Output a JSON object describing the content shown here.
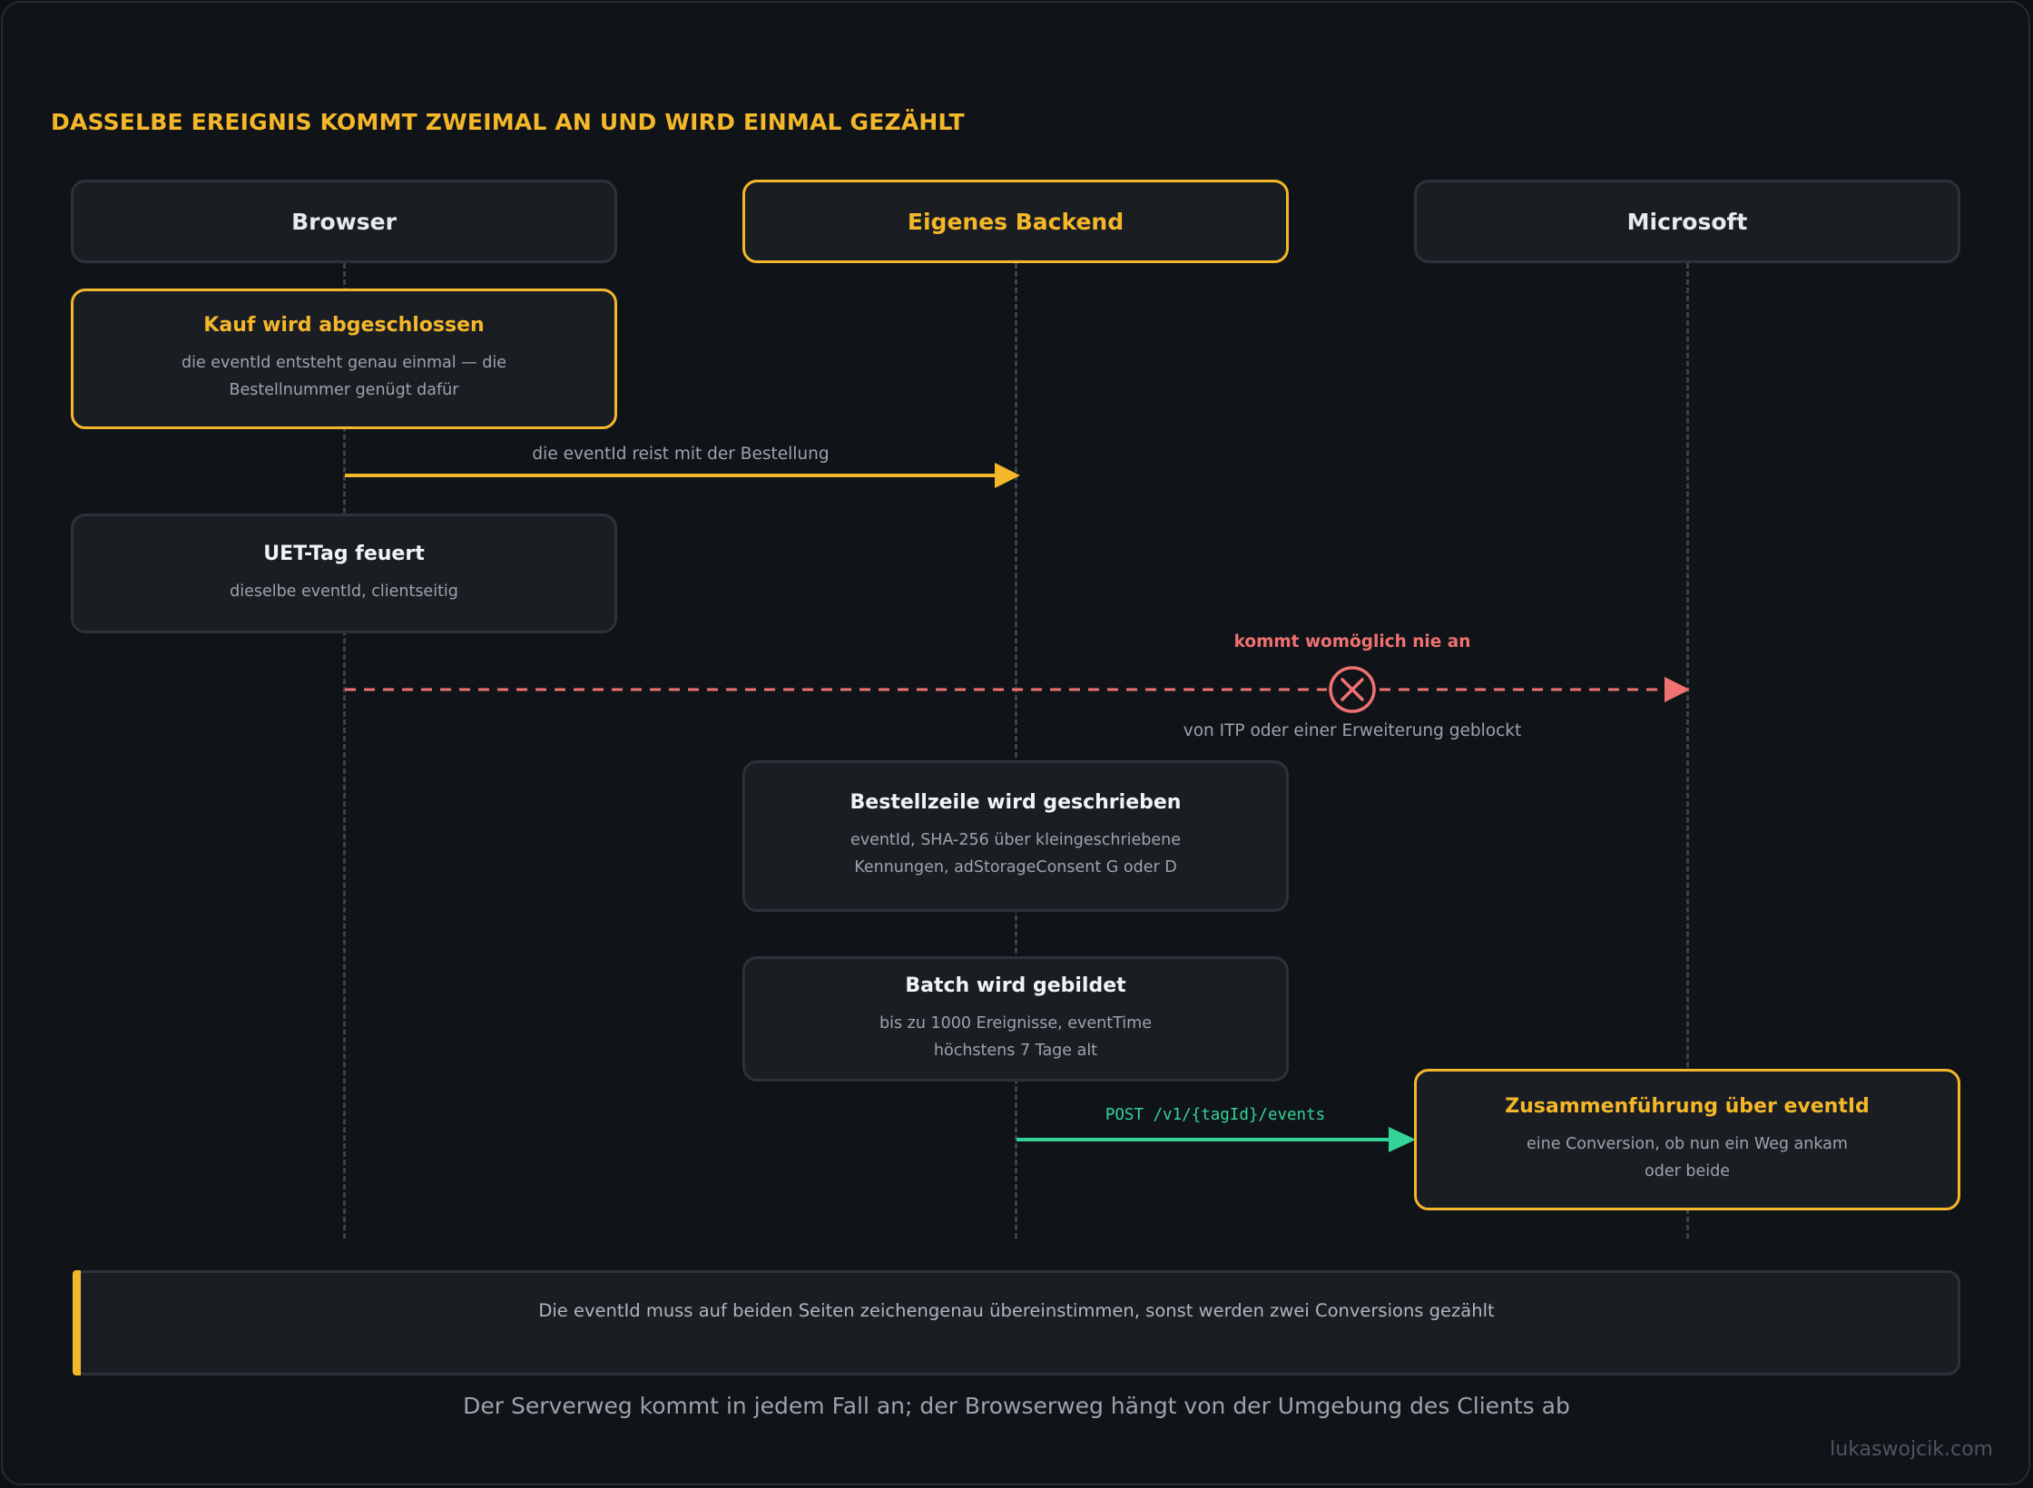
{
  "heading": "DASSELBE EREIGNIS KOMMT ZWEIMAL AN UND WIRD EINMAL GEZÄHLT",
  "lanes": {
    "browser": "Browser",
    "backend": "Eigenes Backend",
    "microsoft": "Microsoft"
  },
  "steps": {
    "kauf": {
      "title": "Kauf wird abgeschlossen",
      "sub": "die eventId entsteht genau einmal — die Bestellnummer genügt dafür"
    },
    "uet": {
      "title": "UET-Tag feuert",
      "sub": "dieselbe eventId, clientseitig"
    },
    "bestellzeile": {
      "title": "Bestellzeile wird geschrieben",
      "sub": "eventId, SHA-256 über kleingeschriebene Kennungen, adStorageConsent G oder D"
    },
    "batch": {
      "title": "Batch wird gebildet",
      "sub": "bis zu 1000 Ereignisse, eventTime höchstens 7 Tage alt"
    },
    "merge": {
      "title": "Zusammenführung über eventId",
      "sub": "eine Conversion, ob nun ein Weg ankam oder beide"
    }
  },
  "messages": {
    "order": "die eventId reist mit der Bestellung",
    "blocked_top": "kommt womöglich nie an",
    "blocked_bottom": "von ITP oder einer Erweiterung geblockt",
    "post": "POST /v1/{tagId}/events"
  },
  "note": "Die eventId muss auf beiden Seiten zeichengenau übereinstimmen, sonst werden zwei Conversions gezählt",
  "caption": "Der Serverweg kommt in jedem Fall an; der Browserweg hängt von der Umgebung des Clients ab",
  "watermark": "lukaswojcik.com",
  "colors": {
    "accent": "#f5b72a",
    "blocked": "#f07171",
    "server": "#34d399",
    "background": "#101418"
  }
}
